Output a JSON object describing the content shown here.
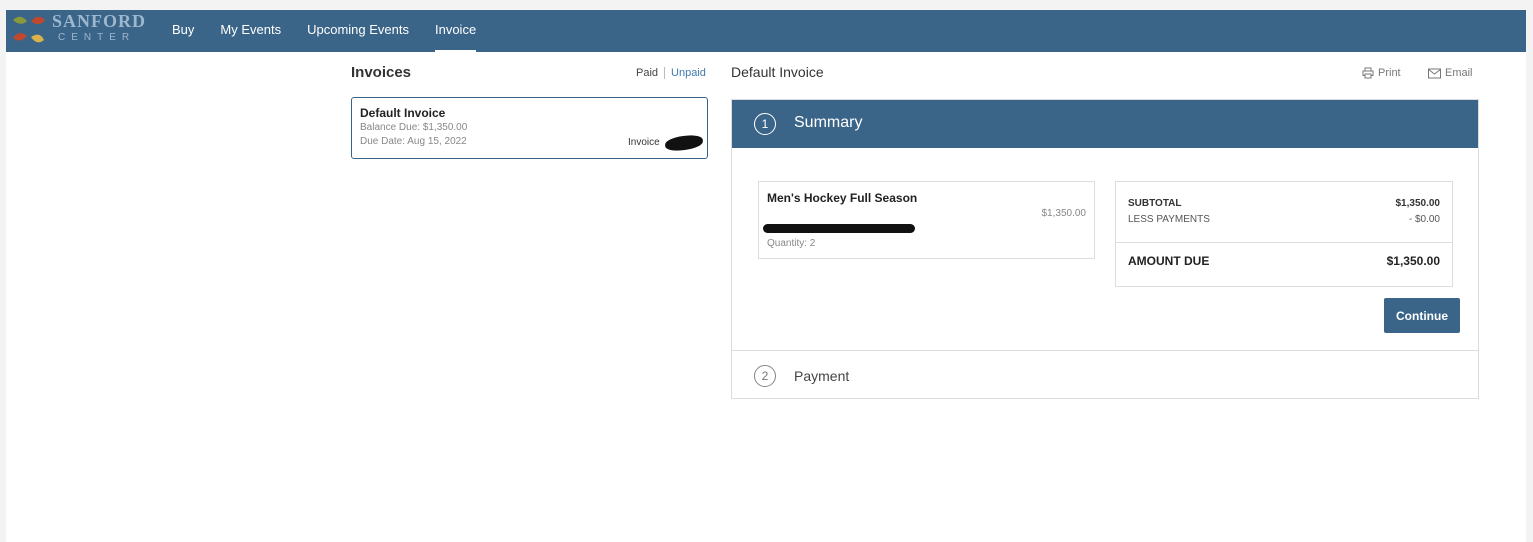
{
  "brand": {
    "logo_word": "SANFORD",
    "logo_sub": "CENTER"
  },
  "nav": {
    "items": [
      {
        "label": "Buy"
      },
      {
        "label": "My Events"
      },
      {
        "label": "Upcoming Events"
      },
      {
        "label": "Invoice",
        "active": true
      }
    ]
  },
  "left": {
    "title": "Invoices",
    "filter": {
      "paid": "Paid",
      "unpaid": "Unpaid"
    },
    "invoice_card": {
      "name": "Default Invoice",
      "balance": "Balance Due: $1,350.00",
      "due_date": "Due Date: Aug 15, 2022",
      "number_label": "Invoice"
    }
  },
  "right": {
    "title": "Default Invoice",
    "print_label": "Print",
    "email_label": "Email",
    "step1": {
      "number": "1",
      "label": "Summary"
    },
    "item": {
      "name": "Men's Hockey Full Season",
      "price": "$1,350.00",
      "quantity": "Quantity: 2"
    },
    "totals": {
      "subtotal_label": "SUBTOTAL",
      "subtotal_value": "$1,350.00",
      "less_label": "LESS PAYMENTS",
      "less_value": "- $0.00",
      "due_label": "AMOUNT DUE",
      "due_value": "$1,350.00"
    },
    "continue_label": "Continue",
    "step2": {
      "number": "2",
      "label": "Payment"
    }
  },
  "colors": {
    "primary": "#3a6589",
    "link": "#3f78b0",
    "background": "#ffffff"
  }
}
